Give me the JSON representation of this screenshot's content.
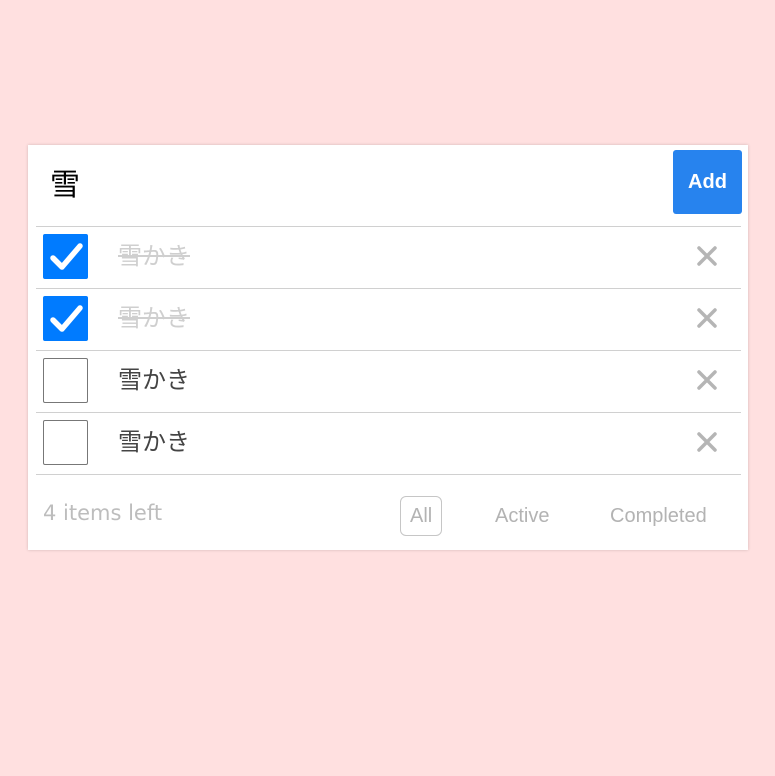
{
  "new_todo": {
    "value": "雪",
    "add_label": "Add"
  },
  "todos": [
    {
      "text": "雪かき",
      "completed": true
    },
    {
      "text": "雪かき",
      "completed": true
    },
    {
      "text": "雪かき",
      "completed": false
    },
    {
      "text": "雪かき",
      "completed": false
    }
  ],
  "footer": {
    "count_label": "4 items left",
    "filters": [
      {
        "label": "All",
        "selected": true
      },
      {
        "label": "Active",
        "selected": false
      },
      {
        "label": "Completed",
        "selected": false
      }
    ]
  },
  "colors": {
    "background": "#ffe0e0",
    "accent": "#007bff",
    "add_button": "#2783ee"
  },
  "icons": {
    "checkbox_checked": "check-icon",
    "delete": "close-icon"
  }
}
